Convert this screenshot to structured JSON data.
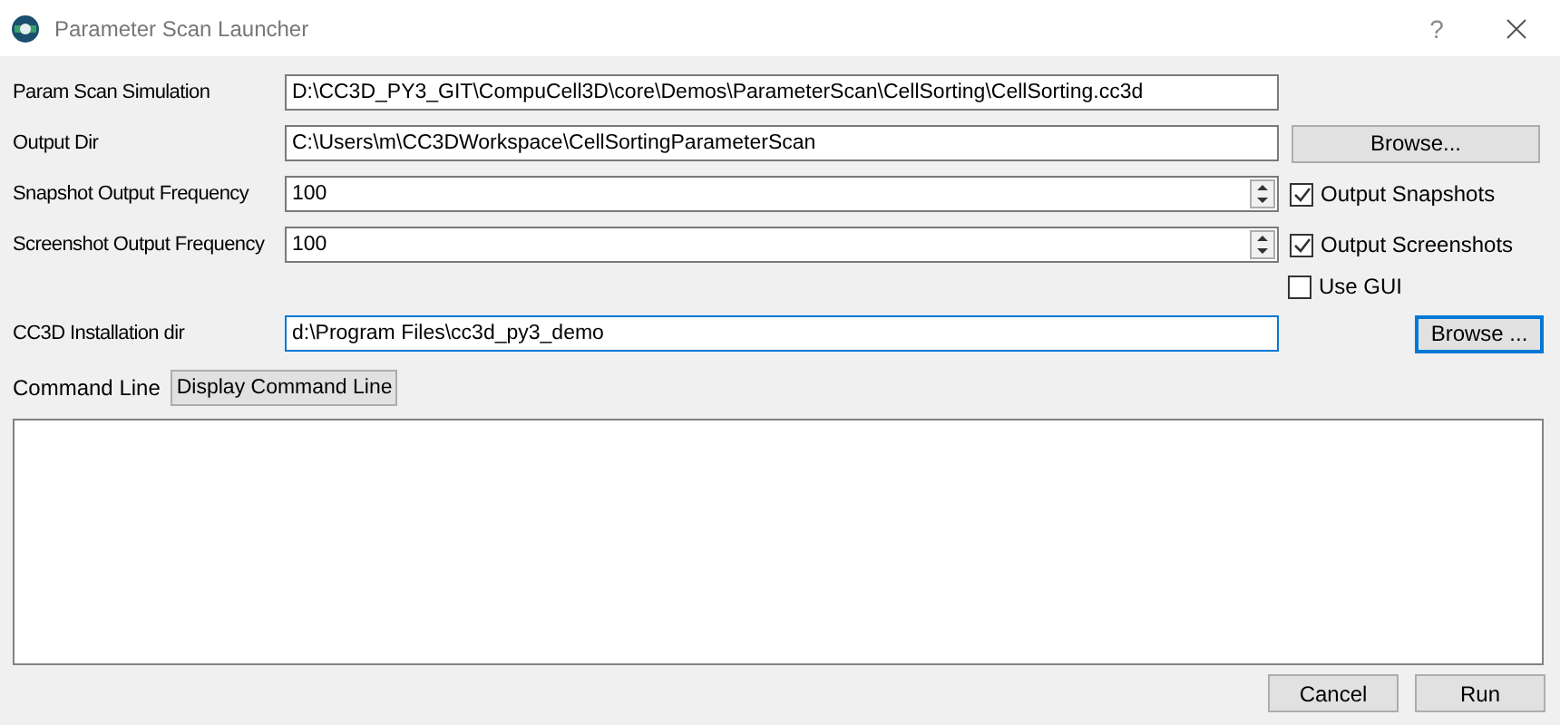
{
  "window": {
    "title": "Parameter Scan Launcher",
    "help": "?"
  },
  "rows": [
    {
      "kind": "path",
      "label": "Param Scan Simulation",
      "value": "D:\\CC3D_PY3_GIT\\CompuCell3D\\core\\Demos\\ParameterScan\\CellSorting\\CellSorting.cc3d",
      "focused": false
    },
    {
      "kind": "path",
      "label": "Output Dir",
      "value": "C:\\Users\\m\\CC3DWorkspace\\CellSortingParameterScan",
      "focused": false,
      "button": {
        "label": "Browse...",
        "focused": false
      }
    },
    {
      "kind": "spin",
      "label": "Snapshot Output Frequency",
      "value": "100",
      "checkbox": {
        "label": "Output Snapshots",
        "checked": true
      }
    },
    {
      "kind": "spin",
      "label": "Screenshot Output Frequency",
      "value": "100",
      "checkbox": {
        "label": "Output Screenshots",
        "checked": true
      }
    },
    {
      "kind": "check",
      "checkbox": {
        "label": "Use GUI",
        "checked": false
      }
    },
    {
      "kind": "path",
      "label": "CC3D Installation dir",
      "value": "d:\\Program Files\\cc3d_py3_demo",
      "focused": true,
      "button": {
        "label": "Browse ...",
        "focused": true
      }
    }
  ],
  "command_line": {
    "label": "Command Line",
    "button": "Display Command Line"
  },
  "buttons": [
    "Cancel",
    "Run"
  ]
}
